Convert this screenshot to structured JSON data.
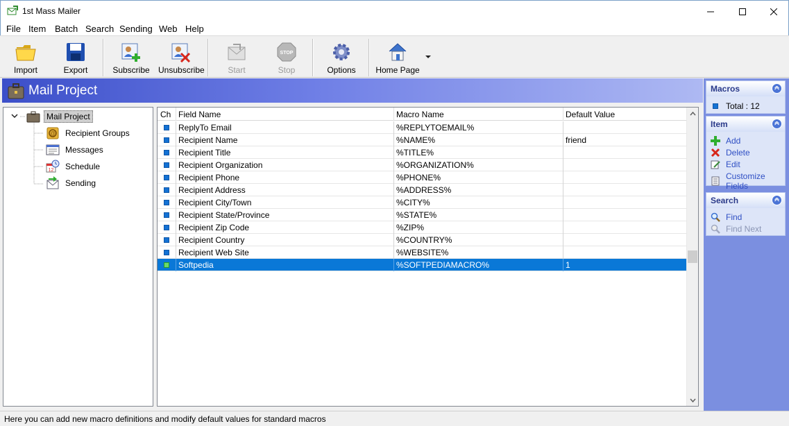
{
  "window": {
    "title": "1st Mass Mailer"
  },
  "menu": [
    "File",
    "Item",
    "Batch",
    "Search",
    "Sending",
    "Web",
    "Help"
  ],
  "toolbar": {
    "import": "Import",
    "export": "Export",
    "subscribe": "Subscribe",
    "unsubscribe": "Unsubscribe",
    "start": "Start",
    "stop": "Stop",
    "stop_badge": "STOP",
    "options": "Options",
    "home_page": "Home Page"
  },
  "header": {
    "title": "Mail Project"
  },
  "tree": {
    "root": "Mail Project",
    "children": [
      "Recipient Groups",
      "Messages",
      "Schedule",
      "Sending"
    ],
    "calendar_glyph": "12"
  },
  "grid": {
    "columns": [
      "Ch",
      "Field Name",
      "Macro Name",
      "Default Value"
    ],
    "rows": [
      {
        "field": "ReplyTo Email",
        "macro": "%REPLYTOEMAIL%",
        "default": ""
      },
      {
        "field": "Recipient Name",
        "macro": "%NAME%",
        "default": "friend"
      },
      {
        "field": "Recipient Title",
        "macro": "%TITLE%",
        "default": ""
      },
      {
        "field": "Recipient Organization",
        "macro": "%ORGANIZATION%",
        "default": ""
      },
      {
        "field": "Recipient Phone",
        "macro": "%PHONE%",
        "default": ""
      },
      {
        "field": "Recipient Address",
        "macro": "%ADDRESS%",
        "default": ""
      },
      {
        "field": "Recipient City/Town",
        "macro": "%CITY%",
        "default": ""
      },
      {
        "field": "Recipient State/Province",
        "macro": "%STATE%",
        "default": ""
      },
      {
        "field": "Recipient Zip Code",
        "macro": "%ZIP%",
        "default": ""
      },
      {
        "field": "Recipient Country",
        "macro": "%COUNTRY%",
        "default": ""
      },
      {
        "field": "Recipient Web Site",
        "macro": "%WEBSITE%",
        "default": ""
      },
      {
        "field": "Softpedia",
        "macro": "%SOFTPEDIAMACRO%",
        "default": "1",
        "selected": true
      }
    ]
  },
  "side": {
    "macros": {
      "title": "Macros",
      "total": "Total : 12"
    },
    "item": {
      "title": "Item",
      "add": "Add",
      "delete": "Delete",
      "edit": "Edit",
      "customize": "Customize Fields"
    },
    "search": {
      "title": "Search",
      "find": "Find",
      "find_next": "Find Next"
    }
  },
  "status": {
    "text": "Here you can add new macro definitions and modify default values for standard macros"
  },
  "colors": {
    "accent": "#0a78d7",
    "header_band": "#3c4fc9",
    "side_panel": "#7b8fe0"
  }
}
